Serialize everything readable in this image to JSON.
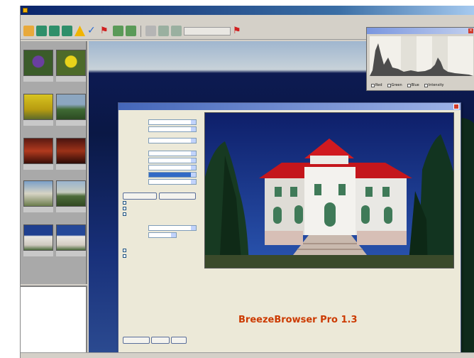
{
  "brand_caption": "BreezeBrowser Pro 1.3",
  "colors": {
    "brand_text": "#cc3a00",
    "titlebar": "#0a246a",
    "panel": "#d4d0c8",
    "dialog": "#ece9d8",
    "roof": "#c4161c"
  },
  "histogram": {
    "options": [
      "Red",
      "Green",
      "Blue",
      "Intensity"
    ]
  },
  "toolbar": {
    "icons": [
      "folder-icon",
      "grid-icon",
      "grid-icon",
      "grid-icon",
      "warning-icon",
      "checkmark-icon",
      "flag-icon",
      "printer-icon",
      "printer-icon",
      "web-icon",
      "back-icon",
      "forward-icon",
      "flag-icon"
    ]
  },
  "preview_image": "building-with-red-roof-photo",
  "thumbnails": [
    {
      "icon": "flower-photo-thumbnail"
    },
    {
      "icon": "flower-photo-thumbnail"
    },
    {
      "icon": "flowers-photo-thumbnail"
    },
    {
      "icon": "landscape-photo-thumbnail"
    },
    {
      "icon": "interior-photo-thumbnail"
    },
    {
      "icon": "interior-photo-thumbnail"
    },
    {
      "icon": "portrait-photo-thumbnail"
    },
    {
      "icon": "landscape-photo-thumbnail"
    },
    {
      "icon": "building-photo-thumbnail"
    },
    {
      "icon": "building-photo-thumbnail"
    }
  ]
}
